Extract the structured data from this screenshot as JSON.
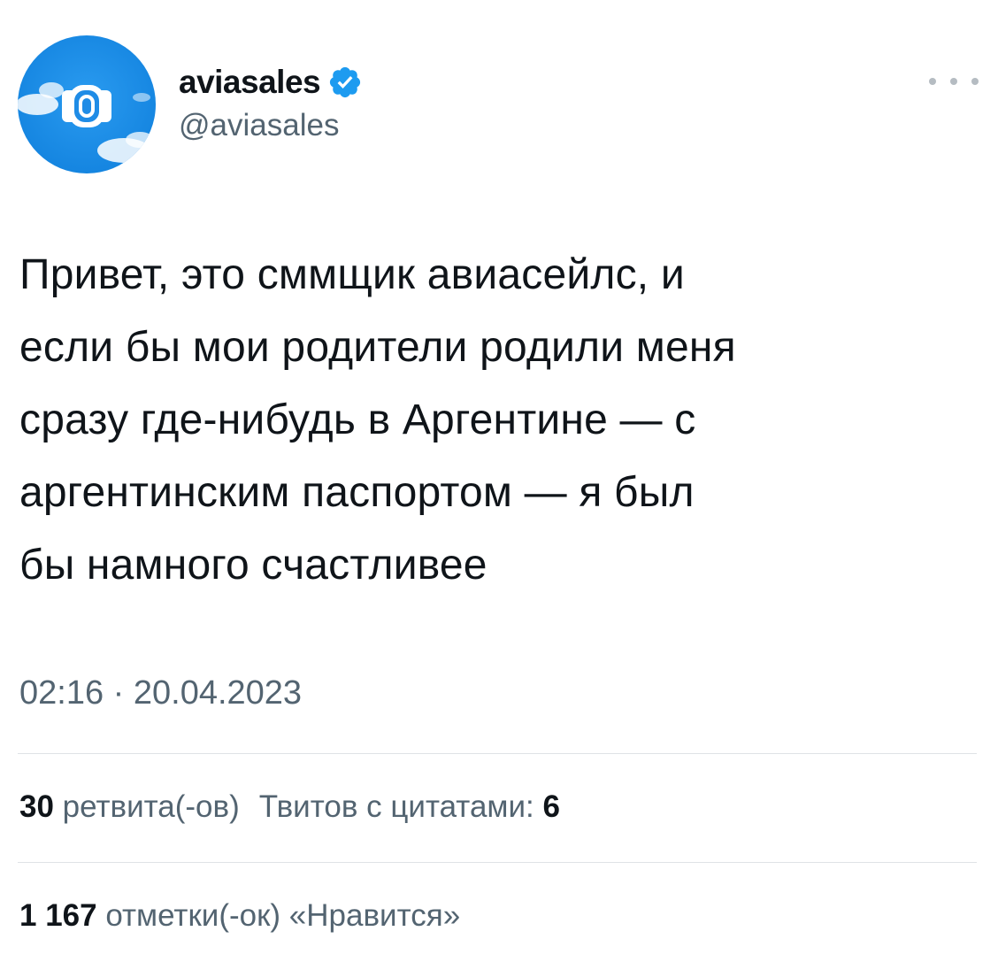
{
  "author": {
    "display_name": "aviasales",
    "handle": "@aviasales",
    "verified": true,
    "avatar_bg": "#1f8ce6"
  },
  "more_icon": "more-horizontal-icon",
  "tweet": {
    "text": "Привет, это сммщик авиасейлс, и\nесли бы мои родители родили меня\nсразу где-нибудь в Аргентине — с\nаргентинским паспортом — я был\nбы намного счастливее",
    "time": "02:16",
    "separator": "·",
    "date": "20.04.2023"
  },
  "stats": {
    "retweets_count": "30",
    "retweets_label": "ретвита(-ов)",
    "quotes_label": "Твитов с цитатами:",
    "quotes_count": "6",
    "likes_count": "1 167",
    "likes_label": "отметки(-ок) «Нравится»"
  },
  "colors": {
    "text": "#0f1419",
    "secondary": "#536471",
    "verified": "#1d9bf0",
    "divider": "#dfe3e6"
  }
}
